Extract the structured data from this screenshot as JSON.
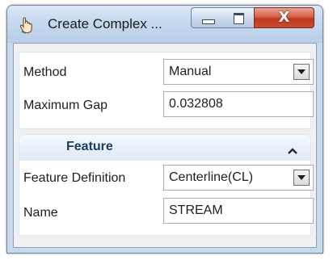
{
  "window": {
    "title": "Create Complex ...",
    "icon": "hand-pointer-icon",
    "controls": [
      "minimize-icon",
      "maximize-icon",
      "close-icon"
    ],
    "close_glyph": "X"
  },
  "general": {
    "method_label": "Method",
    "method_value": "Manual",
    "max_gap_label": "Maximum Gap",
    "max_gap_value": "0.032808"
  },
  "feature": {
    "header": "Feature",
    "header_icon": "chevron-up-icon",
    "definition_label": "Feature Definition",
    "definition_value": "Centerline(CL)",
    "name_label": "Name",
    "name_value": "STREAM"
  },
  "colors": {
    "window_frame": "#c7daee",
    "close_button": "#c0391f",
    "section_header_text": "#1e395b"
  }
}
